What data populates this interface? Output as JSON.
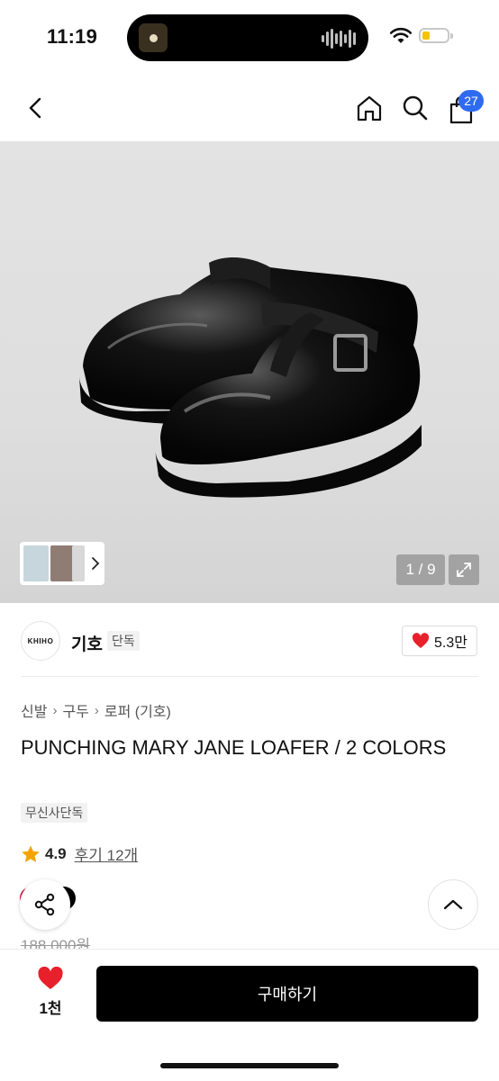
{
  "status_bar": {
    "time": "11:19",
    "battery_level": 0.3,
    "battery_color": "#f5c400"
  },
  "nav": {
    "back_icon": "chevron-left-icon",
    "home_icon": "home-icon",
    "search_icon": "search-icon",
    "cart_icon": "shopping-bag-icon",
    "cart_count": "27",
    "badge_color": "#2f6bf1"
  },
  "gallery": {
    "pager": "1 / 9"
  },
  "brand": {
    "logo_text": "KHIHO",
    "name": "기호",
    "tag": "단독",
    "likes": "5.3만"
  },
  "product": {
    "breadcrumb": [
      "신발",
      "구두",
      "로퍼 (기호)"
    ],
    "title": "PUNCHING MARY JANE LOAFER / 2 COLORS",
    "exclusive_tag": "무신사단독",
    "rating": "4.9",
    "reviews": "후기 12개",
    "original_price": "188,000원"
  },
  "bottom_bar": {
    "wish_count": "1천",
    "buy_label": "구매하기",
    "accent": "#e8202b"
  }
}
